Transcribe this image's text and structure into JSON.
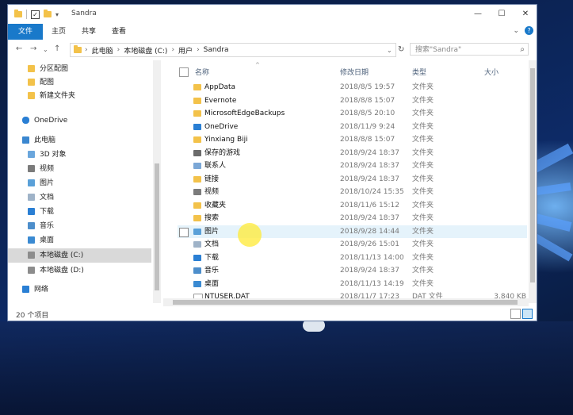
{
  "window": {
    "title": "Sandra"
  },
  "ribbon": {
    "tabs": [
      "文件",
      "主页",
      "共享",
      "查看"
    ],
    "active": "文件"
  },
  "address": {
    "crumbs": [
      "此电脑",
      "本地磁盘 (C:)",
      "用户",
      "Sandra"
    ],
    "search_placeholder": "搜索\"Sandra\""
  },
  "nav": {
    "items": [
      {
        "label": "分区配图",
        "icon": "folder-icon"
      },
      {
        "label": "配图",
        "icon": "folder-icon"
      },
      {
        "label": "新建文件夹",
        "icon": "folder-icon"
      },
      {
        "label": "OneDrive",
        "icon": "cloud-icon"
      },
      {
        "label": "此电脑",
        "icon": "computer-icon"
      },
      {
        "label": "3D 对象",
        "icon": "cube-icon"
      },
      {
        "label": "视频",
        "icon": "video-icon"
      },
      {
        "label": "图片",
        "icon": "picture-icon"
      },
      {
        "label": "文档",
        "icon": "document-icon"
      },
      {
        "label": "下载",
        "icon": "download-icon"
      },
      {
        "label": "音乐",
        "icon": "music-icon"
      },
      {
        "label": "桌面",
        "icon": "desktop-icon"
      },
      {
        "label": "本地磁盘 (C:)",
        "icon": "drive-icon",
        "selected": true
      },
      {
        "label": "本地磁盘 (D:)",
        "icon": "drive-icon"
      },
      {
        "label": "网络",
        "icon": "network-icon"
      }
    ]
  },
  "columns": {
    "name": "名称",
    "date": "修改日期",
    "type": "类型",
    "size": "大小"
  },
  "files": [
    {
      "name": "AppData",
      "date": "2018/8/5 19:57",
      "type": "文件夹",
      "size": "",
      "icon": "folder-icon"
    },
    {
      "name": "Evernote",
      "date": "2018/8/8 15:07",
      "type": "文件夹",
      "size": "",
      "icon": "folder-icon"
    },
    {
      "name": "MicrosoftEdgeBackups",
      "date": "2018/8/5 20:10",
      "type": "文件夹",
      "size": "",
      "icon": "folder-icon"
    },
    {
      "name": "OneDrive",
      "date": "2018/11/9 9:24",
      "type": "文件夹",
      "size": "",
      "icon": "cloud-icon"
    },
    {
      "name": "Yinxiang Biji",
      "date": "2018/8/8 15:07",
      "type": "文件夹",
      "size": "",
      "icon": "folder-icon"
    },
    {
      "name": "保存的游戏",
      "date": "2018/9/24 18:37",
      "type": "文件夹",
      "size": "",
      "icon": "saved-games-icon"
    },
    {
      "name": "联系人",
      "date": "2018/9/24 18:37",
      "type": "文件夹",
      "size": "",
      "icon": "contacts-icon"
    },
    {
      "name": "链接",
      "date": "2018/9/24 18:37",
      "type": "文件夹",
      "size": "",
      "icon": "links-icon"
    },
    {
      "name": "视频",
      "date": "2018/10/24 15:35",
      "type": "文件夹",
      "size": "",
      "icon": "video-icon"
    },
    {
      "name": "收藏夹",
      "date": "2018/11/6 15:12",
      "type": "文件夹",
      "size": "",
      "icon": "favorites-icon"
    },
    {
      "name": "搜索",
      "date": "2018/9/24 18:37",
      "type": "文件夹",
      "size": "",
      "icon": "search-folder-icon"
    },
    {
      "name": "图片",
      "date": "2018/9/28 14:44",
      "type": "文件夹",
      "size": "",
      "icon": "picture-icon",
      "hover": true
    },
    {
      "name": "文档",
      "date": "2018/9/26 15:01",
      "type": "文件夹",
      "size": "",
      "icon": "document-icon"
    },
    {
      "name": "下载",
      "date": "2018/11/13 14:00",
      "type": "文件夹",
      "size": "",
      "icon": "download-icon"
    },
    {
      "name": "音乐",
      "date": "2018/9/24 18:37",
      "type": "文件夹",
      "size": "",
      "icon": "music-icon"
    },
    {
      "name": "桌面",
      "date": "2018/11/13 14:19",
      "type": "文件夹",
      "size": "",
      "icon": "desktop-icon"
    },
    {
      "name": "NTUSER.DAT",
      "date": "2018/11/7 17:23",
      "type": "DAT 文件",
      "size": "3,840 KB",
      "icon": "file-icon"
    }
  ],
  "status": {
    "count": "20 个项目"
  },
  "colors": {
    "accent": "#1979ca",
    "folder": "#f3c24a",
    "hover_row": "#e5f3fb",
    "cursor_highlight": "#ffeb3c"
  }
}
